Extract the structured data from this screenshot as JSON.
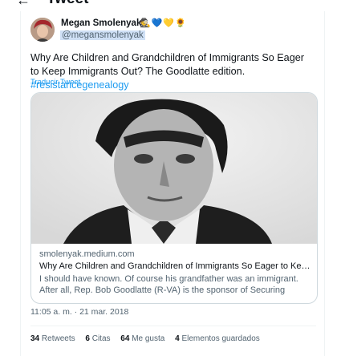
{
  "header": {
    "title": "Tweet"
  },
  "author": {
    "name": "Megan Smolenyak",
    "emoji": "🕵️💙💛🌻",
    "handle": "@megansmolenyak"
  },
  "tweet": {
    "text": "Why Are Children and Grandchildren of Immigrants So Eager to Keep Immigrants Out? The Goodlatte edition.",
    "hashtag": "#resistancegenealogy",
    "translate": "Traducir Tweet",
    "timestamp": "11:05 a. m. · 21 mar. 2018"
  },
  "card": {
    "domain": "smolenyak.medium.com",
    "title": "Why Are Children and Grandchildren of Immigrants So Eager to Keep Immigra…",
    "description": "I should have known. Of course his grandfather was an immigrant. After all, Rep. Bob Goodlatte (R-VA) is the sponsor of Securing America's…"
  },
  "stats": [
    {
      "count": "34",
      "label": "Retweets"
    },
    {
      "count": "6",
      "label": "Citas"
    },
    {
      "count": "64",
      "label": "Me gusta"
    },
    {
      "count": "4",
      "label": "Elementos guardados"
    }
  ],
  "colors": {
    "link": "#1d9bf0",
    "secondary": "#536471",
    "border": "#cfd9de"
  }
}
